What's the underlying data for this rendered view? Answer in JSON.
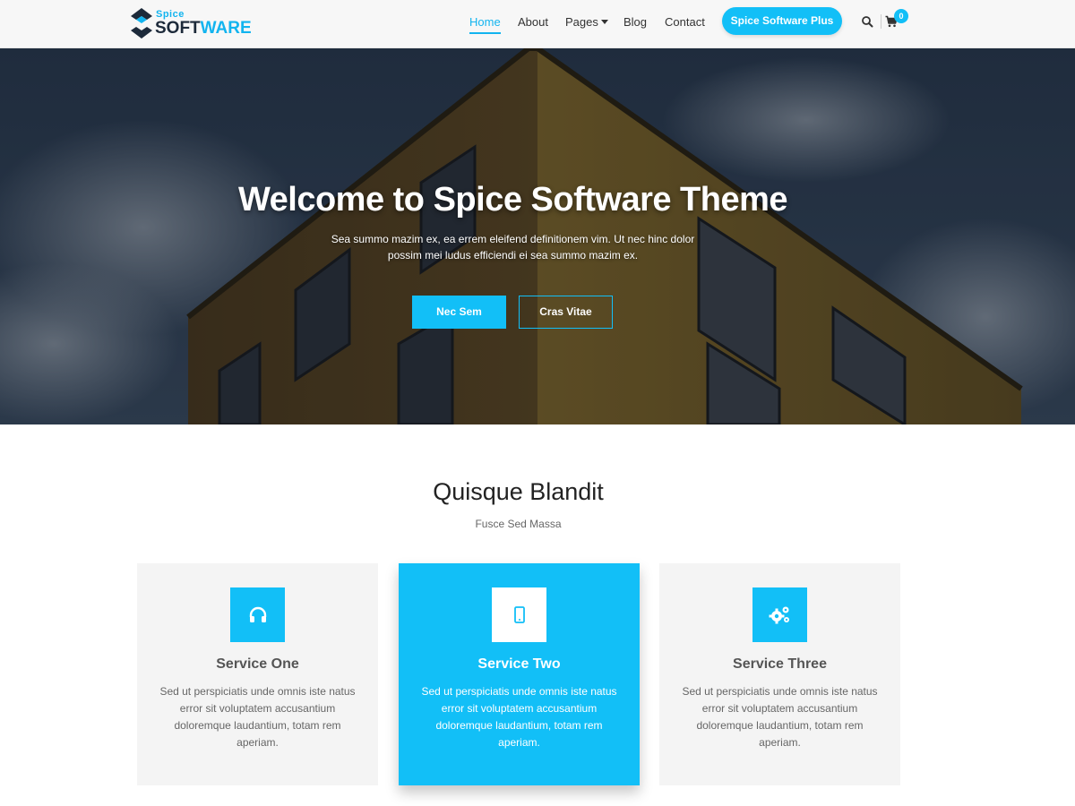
{
  "brand": {
    "small": "Spice",
    "big_part1": "SOFT",
    "big_part2": "WARE"
  },
  "nav": {
    "items": [
      {
        "label": "Home",
        "active": true
      },
      {
        "label": "About"
      },
      {
        "label": "Pages",
        "has_dropdown": true
      },
      {
        "label": "Blog"
      },
      {
        "label": "Contact"
      }
    ],
    "cta_label": "Spice Software Plus",
    "search_icon": "search-icon",
    "cart_icon": "cart-icon",
    "cart_count": "0"
  },
  "hero": {
    "title": "Welcome to Spice Software Theme",
    "text": "Sea summo mazim ex, ea errem eleifend definitionem vim. Ut nec hinc dolor possim mei ludus efficiendi ei sea summo mazim ex.",
    "button_primary": "Nec Sem",
    "button_secondary": "Cras Vitae"
  },
  "services": {
    "title": "Quisque Blandit",
    "subtitle": "Fusce Sed Massa",
    "cards": [
      {
        "icon": "headphones-icon",
        "title": "Service One",
        "text": "Sed ut perspiciatis unde omnis iste natus error sit voluptatem accusantium doloremque laudantium, totam rem aperiam."
      },
      {
        "icon": "mobile-icon",
        "title": "Service Two",
        "text": "Sed ut perspiciatis unde omnis iste natus error sit voluptatem accusantium doloremque laudantium, totam rem aperiam.",
        "highlighted": true
      },
      {
        "icon": "gears-icon",
        "title": "Service Three",
        "text": "Sed ut perspiciatis unde omnis iste natus error sit voluptatem accusantium doloremque laudantium, totam rem aperiam."
      }
    ]
  },
  "colors": {
    "accent": "#12bff7",
    "dark": "#1d2a3a",
    "card_bg": "#f4f4f4"
  }
}
